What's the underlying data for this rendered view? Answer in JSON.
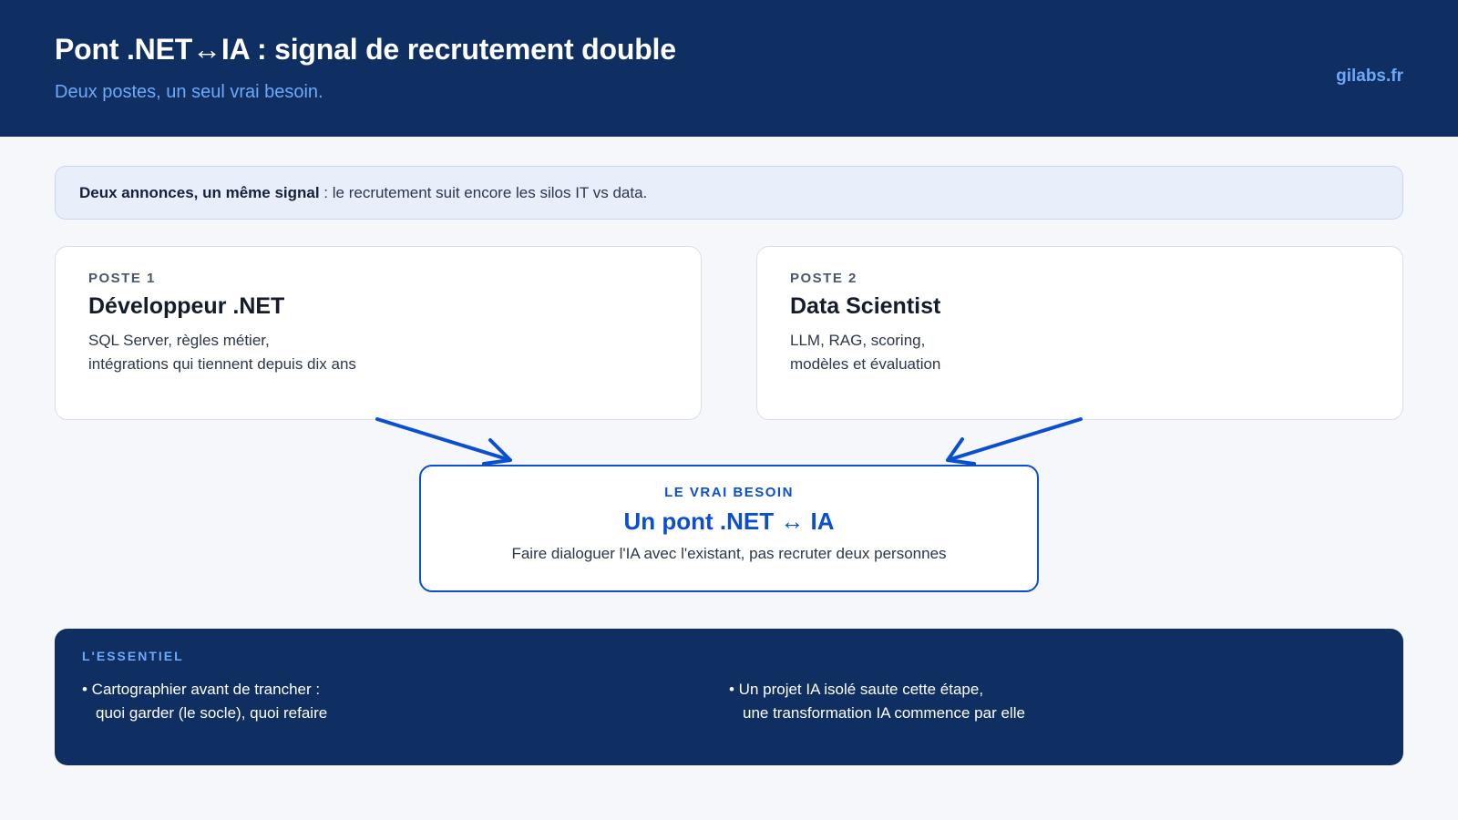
{
  "header": {
    "title": "Pont .NET↔IA : signal de recrutement double",
    "subtitle": "Deux postes, un seul vrai besoin.",
    "brand": "gilabs.fr"
  },
  "notice": {
    "strong": "Deux annonces, un même signal",
    "rest": " : le recrutement suit encore les silos IT vs data."
  },
  "cards": [
    {
      "kicker": "POSTE 1",
      "title": "Développeur .NET",
      "lines": [
        "SQL Server, règles métier,",
        "intégrations qui tiennent depuis dix ans"
      ]
    },
    {
      "kicker": "POSTE 2",
      "title": "Data Scientist",
      "lines": [
        "LLM, RAG, scoring,",
        "modèles et évaluation"
      ]
    }
  ],
  "need": {
    "kicker": "LE VRAI BESOIN",
    "title": "Un pont .NET ↔ IA",
    "desc": "Faire dialoguer l'IA avec l'existant, pas recruter deux personnes"
  },
  "essentials": {
    "kicker": "L'ESSENTIEL",
    "items": [
      {
        "line1": "• Cartographier avant de trancher :",
        "line2": "quoi garder (le socle), quoi refaire"
      },
      {
        "line1": "• Un projet IA isolé saute cette étape,",
        "line2": "une transformation IA commence par elle"
      }
    ]
  },
  "colors": {
    "navy": "#0f2f62",
    "accent": "#0b4fd1",
    "light_accent": "#6ea8f7"
  }
}
